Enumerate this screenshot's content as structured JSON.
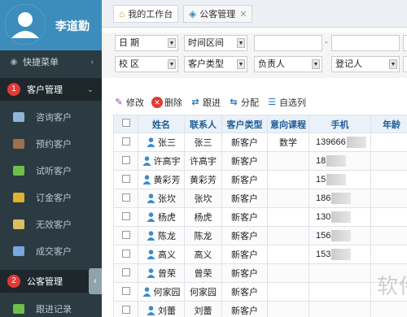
{
  "user": {
    "name": "李道勤"
  },
  "sidebar": {
    "quick_menu": "快捷菜单",
    "customer_mgmt": {
      "label": "客户管理",
      "badge": "1"
    },
    "items": [
      {
        "label": "咨询客户",
        "color": "#8fb4d8"
      },
      {
        "label": "预约客户",
        "color": "#a0704a"
      },
      {
        "label": "试听客户",
        "color": "#6fbf4a"
      },
      {
        "label": "订金客户",
        "color": "#e0b030"
      },
      {
        "label": "无效客户",
        "color": "#d9c060"
      },
      {
        "label": "成交客户",
        "color": "#7aa7e0"
      }
    ],
    "public_mgmt": {
      "label": "公客管理",
      "badge": "2"
    },
    "followup": "跟进记录"
  },
  "tabs": [
    {
      "label": "我的工作台",
      "icon": "home-icon"
    },
    {
      "label": "公客管理",
      "icon": "tag-icon",
      "closable": true
    }
  ],
  "filters": {
    "date": "日 期",
    "time_range": "时间区间",
    "campus": "校 区",
    "customer_type": "客户类型",
    "owner": "负责人",
    "registrar": "登记人",
    "dash": "-"
  },
  "toolbar": {
    "edit": "修改",
    "delete": "删除",
    "follow": "跟进",
    "assign": "分配",
    "custom": "自选列"
  },
  "table": {
    "headers": [
      "姓名",
      "联系人",
      "客户类型",
      "意向课程",
      "手机",
      "年龄"
    ],
    "rows": [
      {
        "name": "张三",
        "contact": "张三",
        "type": "新客户",
        "course": "数学",
        "phone": "139666"
      },
      {
        "name": "许高宇",
        "contact": "许高宇",
        "type": "新客户",
        "course": "",
        "phone": "18"
      },
      {
        "name": "黄彩芳",
        "contact": "黄彩芳",
        "type": "新客户",
        "course": "",
        "phone": "15"
      },
      {
        "name": "张坎",
        "contact": "张坎",
        "type": "新客户",
        "course": "",
        "phone": "186"
      },
      {
        "name": "杨虎",
        "contact": "杨虎",
        "type": "新客户",
        "course": "",
        "phone": "130"
      },
      {
        "name": "陈龙",
        "contact": "陈龙",
        "type": "新客户",
        "course": "",
        "phone": "156"
      },
      {
        "name": "高义",
        "contact": "高义",
        "type": "新客户",
        "course": "",
        "phone": "153"
      },
      {
        "name": "曾荣",
        "contact": "曾荣",
        "type": "新客户",
        "course": "",
        "phone": ""
      },
      {
        "name": "何家园",
        "contact": "何家园",
        "type": "新客户",
        "course": "",
        "phone": ""
      },
      {
        "name": "刘蕾",
        "contact": "刘蕾",
        "type": "新客户",
        "course": "",
        "phone": ""
      }
    ]
  },
  "watermark": "软件技巧"
}
